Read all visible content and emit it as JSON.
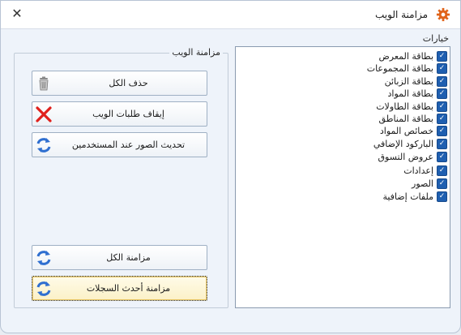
{
  "window": {
    "title": "مزامنة الويب"
  },
  "options": {
    "label": "خيارات",
    "items": [
      {
        "label": "بطاقة المعرض",
        "checked": true
      },
      {
        "label": "بطاقة المجموعات",
        "checked": true
      },
      {
        "label": "بطاقة الزبائن",
        "checked": true
      },
      {
        "label": "بطاقة المواد",
        "checked": true
      },
      {
        "label": "بطاقة الطاولات",
        "checked": true
      },
      {
        "label": "بطاقة المناطق",
        "checked": true
      },
      {
        "label": "خصائص المواد",
        "checked": true
      },
      {
        "label": "الباركود الإضافي",
        "checked": true
      },
      {
        "label": "عروض التسوق",
        "checked": true
      },
      {
        "label": "إعدادات",
        "checked": true
      },
      {
        "label": "الصور",
        "checked": true
      },
      {
        "label": "ملفات إضافية",
        "checked": true
      }
    ]
  },
  "sync_group": {
    "title": "مزامنة الويب",
    "buttons": {
      "delete_all": "حذف الكل",
      "stop_web_orders": "إيقاف طلبات الويب",
      "update_images": "تحديث الصور عند المستخدمين",
      "sync_all": "مزامنة الكل",
      "sync_latest": "مزامنة أحدث السجلات"
    }
  },
  "colors": {
    "accent": "#1f5fb0",
    "icon_red": "#e0201c",
    "icon_blue": "#2f6fd0",
    "gear": "#e0641c"
  }
}
